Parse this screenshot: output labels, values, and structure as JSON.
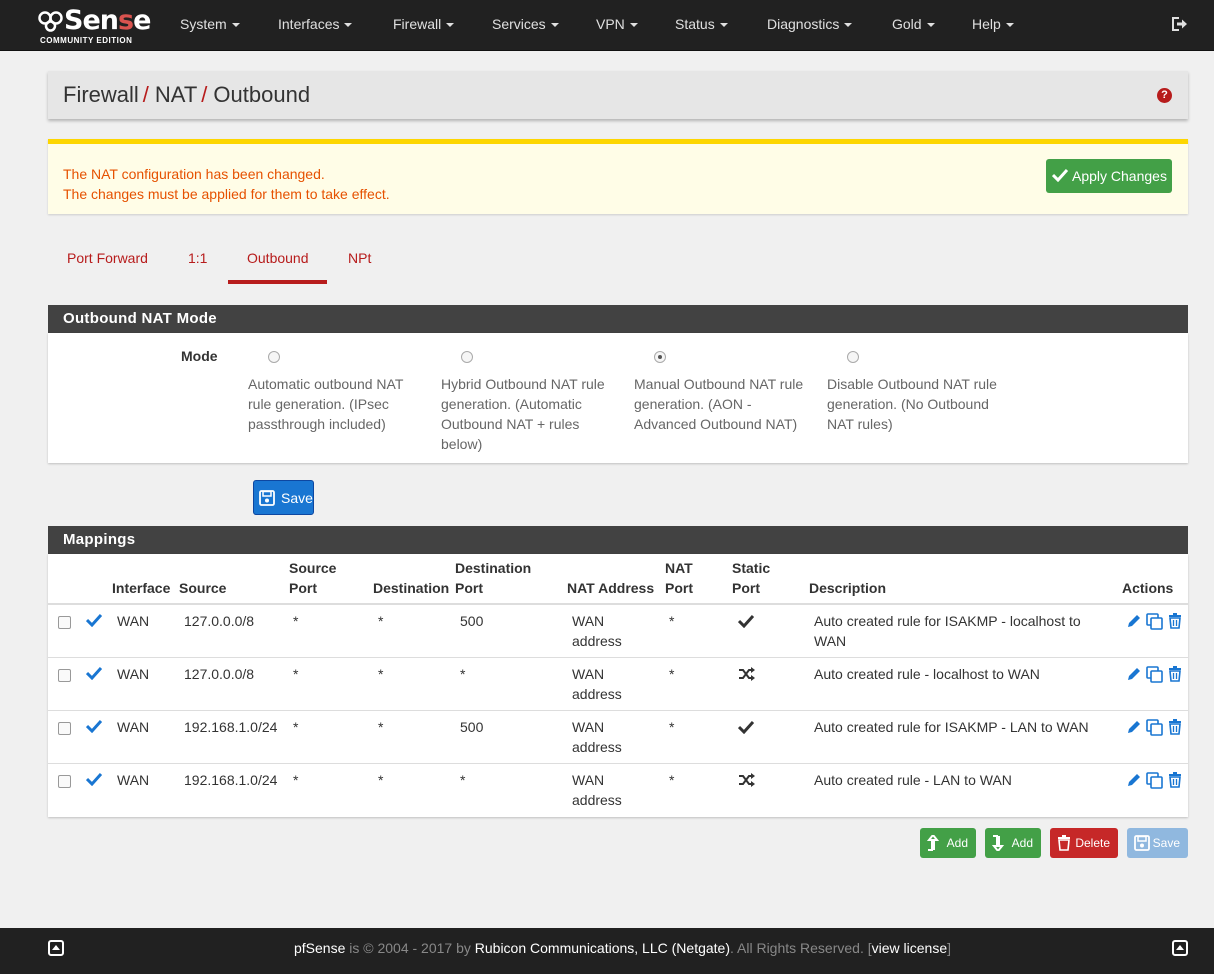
{
  "logo": {
    "main_a": "Sen",
    "main_b": "s",
    "main_c": "e",
    "sub": "COMMUNITY EDITION"
  },
  "nav": {
    "items": [
      "System",
      "Interfaces",
      "Firewall",
      "Services",
      "VPN",
      "Status",
      "Diagnostics",
      "Gold",
      "Help"
    ]
  },
  "breadcrumb": {
    "part1": "Firewall",
    "part2": "NAT",
    "part3": "Outbound",
    "sep": "/"
  },
  "alert": {
    "line1": "The NAT configuration has been changed.",
    "line2": "The changes must be applied for them to take effect.",
    "apply_label": "Apply Changes"
  },
  "tabs": [
    "Port Forward",
    "1:1",
    "Outbound",
    "NPt"
  ],
  "active_tab": "Outbound",
  "mode_panel": {
    "title": "Outbound NAT Mode",
    "label": "Mode",
    "options": [
      {
        "text": "Automatic outbound NAT rule generation. (IPsec passthrough included)",
        "checked": false
      },
      {
        "text": "Hybrid Outbound NAT rule generation. (Automatic Outbound NAT + rules below)",
        "checked": false
      },
      {
        "text": "Manual Outbound NAT rule generation. (AON - Advanced Outbound NAT)",
        "checked": true
      },
      {
        "text": "Disable Outbound NAT rule generation. (No Outbound NAT rules)",
        "checked": false
      }
    ],
    "save_label": "Save"
  },
  "mappings": {
    "title": "Mappings",
    "headers": {
      "interface": "Interface",
      "source": "Source",
      "source_port_1": "Source",
      "source_port_2": "Port",
      "destination": "Destination",
      "dest_port_1": "Destination",
      "dest_port_2": "Port",
      "nat_address": "NAT Address",
      "nat_port_1": "NAT",
      "nat_port_2": "Port",
      "static_port_1": "Static",
      "static_port_2": "Port",
      "description": "Description",
      "actions": "Actions"
    },
    "rows": [
      {
        "interface": "WAN",
        "source": "127.0.0.0/8",
        "source_port": "*",
        "destination": "*",
        "dest_port": "500",
        "nat_addr_1": "WAN",
        "nat_addr_2": "address",
        "nat_port": "*",
        "static": "check",
        "desc_1": "Auto created rule for ISAKMP - localhost to",
        "desc_2": "WAN"
      },
      {
        "interface": "WAN",
        "source": "127.0.0.0/8",
        "source_port": "*",
        "destination": "*",
        "dest_port": "*",
        "nat_addr_1": "WAN",
        "nat_addr_2": "address",
        "nat_port": "*",
        "static": "random",
        "desc_1": "Auto created rule - localhost to WAN",
        "desc_2": ""
      },
      {
        "interface": "WAN",
        "source": "192.168.1.0/24",
        "source_port": "*",
        "destination": "*",
        "dest_port": "500",
        "nat_addr_1": "WAN",
        "nat_addr_2": "address",
        "nat_port": "*",
        "static": "check",
        "desc_1": "Auto created rule for ISAKMP - LAN to WAN",
        "desc_2": ""
      },
      {
        "interface": "WAN",
        "source": "192.168.1.0/24",
        "source_port": "*",
        "destination": "*",
        "dest_port": "*",
        "nat_addr_1": "WAN",
        "nat_addr_2": "address",
        "nat_port": "*",
        "static": "random",
        "desc_1": "Auto created rule - LAN to WAN",
        "desc_2": ""
      }
    ]
  },
  "bottom_buttons": {
    "add_top": "Add",
    "add_bottom": "Add",
    "delete": "Delete",
    "save": "Save"
  },
  "footer": {
    "brand": "pfSense",
    "mid": " is © 2004 - 2017 by ",
    "company": "Rubicon Communications, LLC (Netgate)",
    "rights": ". All Rights Reserved. [",
    "license": "view license",
    "end": "]"
  },
  "colors": {
    "accent": "#b71c1c",
    "navbar": "#212121",
    "panel_head": "#424242",
    "success": "#43a047",
    "primary": "#1976d2",
    "danger": "#d32f2f"
  }
}
